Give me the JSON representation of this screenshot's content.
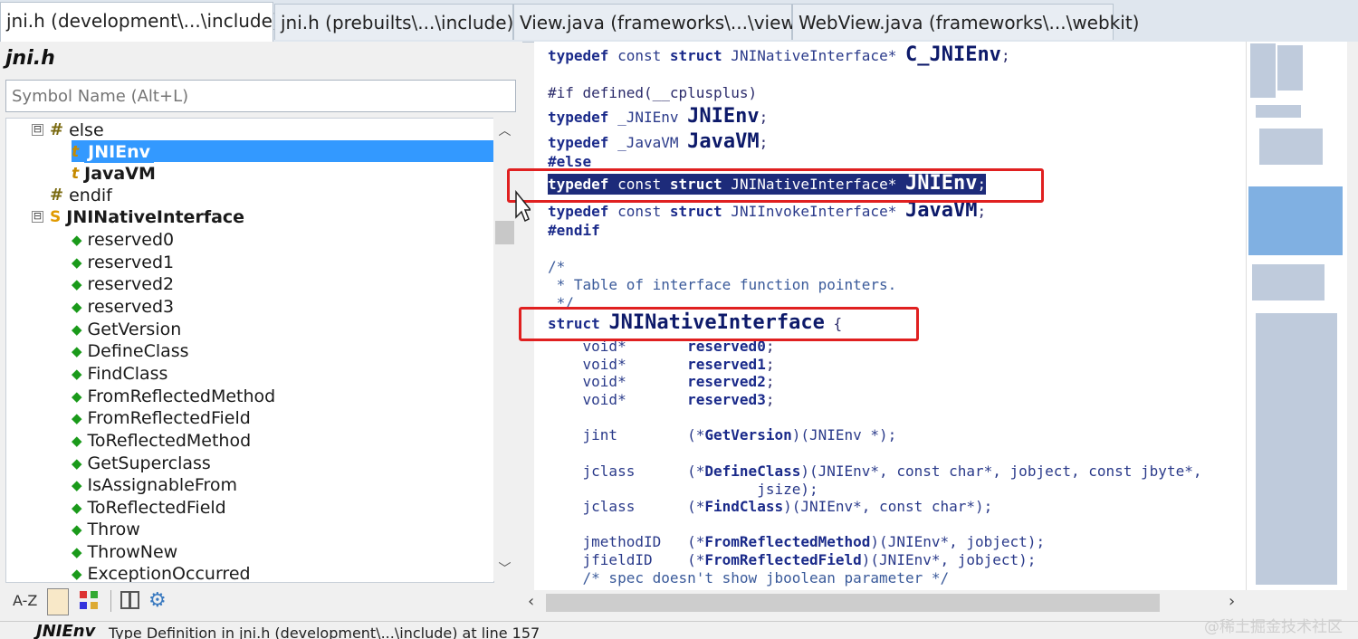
{
  "tabs": [
    {
      "label": "jni.h (development\\...\\include)",
      "close": "✖"
    },
    {
      "label": "jni.h (prebuilts\\...\\include)"
    },
    {
      "label": "View.java (frameworks\\...\\view)"
    },
    {
      "label": "WebView.java (frameworks\\...\\webkit)"
    }
  ],
  "symbol_panel": {
    "title": "jni.h",
    "search_placeholder": "Symbol Name (Alt+L)",
    "tree": [
      {
        "label": "else",
        "icon": "hash-icon",
        "expander": "⊟"
      },
      {
        "label": "JNIEnv",
        "icon": "typedef-icon",
        "selected": true
      },
      {
        "label": "JavaVM",
        "icon": "typedef-icon"
      },
      {
        "label": "endif",
        "icon": "hash-icon"
      },
      {
        "label": "JNINativeInterface",
        "icon": "struct-icon",
        "expander": "⊟"
      },
      {
        "label": "reserved0",
        "icon": "member-icon"
      },
      {
        "label": "reserved1",
        "icon": "member-icon"
      },
      {
        "label": "reserved2",
        "icon": "member-icon"
      },
      {
        "label": "reserved3",
        "icon": "member-icon"
      },
      {
        "label": "GetVersion",
        "icon": "member-icon"
      },
      {
        "label": "DefineClass",
        "icon": "member-icon"
      },
      {
        "label": "FindClass",
        "icon": "member-icon"
      },
      {
        "label": "FromReflectedMethod",
        "icon": "member-icon"
      },
      {
        "label": "FromReflectedField",
        "icon": "member-icon"
      },
      {
        "label": "ToReflectedMethod",
        "icon": "member-icon"
      },
      {
        "label": "GetSuperclass",
        "icon": "member-icon"
      },
      {
        "label": "IsAssignableFrom",
        "icon": "member-icon"
      },
      {
        "label": "ToReflectedField",
        "icon": "member-icon"
      },
      {
        "label": "Throw",
        "icon": "member-icon"
      },
      {
        "label": "ThrowNew",
        "icon": "member-icon"
      },
      {
        "label": "ExceptionOccurred",
        "icon": "member-icon"
      }
    ],
    "toolbar": {
      "az": "A-Z"
    }
  },
  "code": {
    "l1_kw": "typedef",
    "l1_a": " const ",
    "l1_kw2": "struct",
    "l1_b": " JNINativeInterface* ",
    "l1_name": "C_JNIEnv",
    "l1_end": ";",
    "l2": "#if defined(__cplusplus)",
    "l3_kw": "typedef",
    "l3_a": " _JNIEnv ",
    "l3_name": "JNIEnv",
    "l3_end": ";",
    "l4_kw": "typedef",
    "l4_a": " _JavaVM ",
    "l4_name": "JavaVM",
    "l4_end": ";",
    "l5": "#else",
    "l6_kw": "typedef",
    "l6_a": " const ",
    "l6_kw2": "struct",
    "l6_b": " JNINativeInterface* ",
    "l6_name": "JNIEnv",
    "l6_end": ";",
    "l7_kw": "typedef",
    "l7_a": " const ",
    "l7_kw2": "struct",
    "l7_b": " JNIInvokeInterface* ",
    "l7_name": "JavaVM",
    "l7_end": ";",
    "l8": "#endif",
    "c1": "/*",
    "c2": " * Table of interface function pointers.",
    "c3": " */",
    "s_kw": "struct",
    "s_name": "JNINativeInterface",
    "s_brace": " {",
    "r0_t": "    void*       ",
    "r0_n": "reserved0",
    "r0_e": ";",
    "r1_t": "    void*       ",
    "r1_n": "reserved1",
    "r1_e": ";",
    "r2_t": "    void*       ",
    "r2_n": "reserved2",
    "r2_e": ";",
    "r3_t": "    void*       ",
    "r3_n": "reserved3",
    "r3_e": ";",
    "gv_t": "    jint        (*",
    "gv_n": "GetVersion",
    "gv_e": ")(JNIEnv *);",
    "dc_t": "    jclass      (*",
    "dc_n": "DefineClass",
    "dc_e": ")(JNIEnv*, const char*, jobject, const jbyte*,",
    "dc2": "                        jsize);",
    "fc_t": "    jclass      (*",
    "fc_n": "FindClass",
    "fc_e": ")(JNIEnv*, const char*);",
    "frm_t": "    jmethodID   (*",
    "frm_n": "FromReflectedMethod",
    "frm_e": ")(JNIEnv*, jobject);",
    "frf_t": "    jfieldID    (*",
    "frf_n": "FromReflectedField",
    "frf_e": ")(JNIEnv*, jobject);",
    "spec": "    /* spec doesn't show jboolean parameter */"
  },
  "status": {
    "name": "JNIEnv",
    "description": "Type Definition in jni.h (development\\...\\include) at line 157"
  },
  "watermark": "@稀土掘金技术社区",
  "colors": {
    "selection": "#1d2b7a",
    "highlight_box": "#e02020",
    "tree_selection": "#3399ff"
  }
}
